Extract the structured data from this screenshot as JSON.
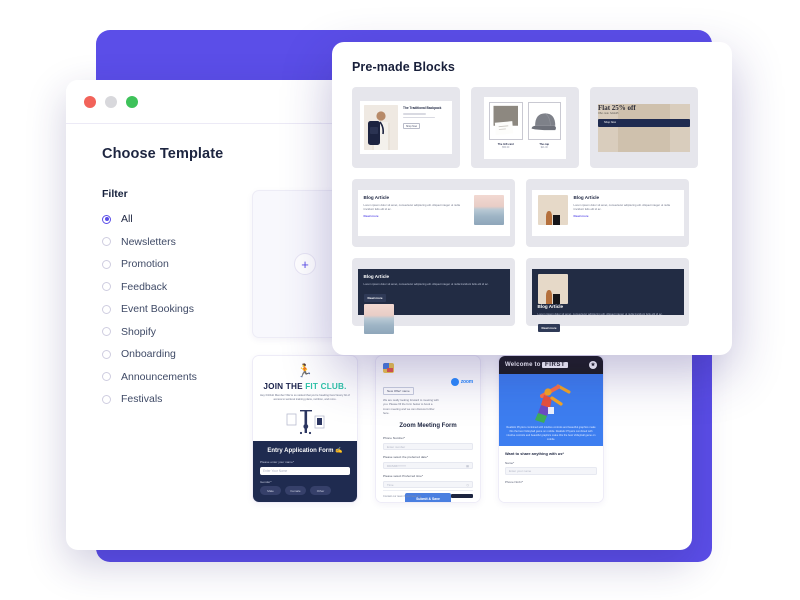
{
  "backdrop": {
    "color": "#5b4ee8"
  },
  "window": {
    "traffic_lights": [
      "close",
      "minimize",
      "maximize"
    ],
    "page_title": "Choose Template"
  },
  "filter": {
    "heading": "Filter",
    "items": [
      {
        "label": "All",
        "selected": true
      },
      {
        "label": "Newsletters",
        "selected": false
      },
      {
        "label": "Promotion",
        "selected": false
      },
      {
        "label": "Feedback",
        "selected": false
      },
      {
        "label": "Event Bookings",
        "selected": false
      },
      {
        "label": "Shopify",
        "selected": false
      },
      {
        "label": "Onboarding",
        "selected": false
      },
      {
        "label": "Announcements",
        "selected": false
      },
      {
        "label": "Festivals",
        "selected": false
      }
    ]
  },
  "templates": {
    "add_card": {
      "icon": "plus-icon",
      "label": "+"
    },
    "fit_club": {
      "icon": "runner-icon",
      "title_1": "JOIN THE ",
      "title_2": "FIT CLUB.",
      "subtitle": "Hey FitClub Member!\nWe're so stoked that you're heading here! Every bit of access to workout training plans, nutrition, and more.",
      "form_title": "Entry Application Form",
      "form_emoji": "✍",
      "name_label": "Please enter your name*",
      "name_placeholder": "Enter Your Name",
      "gender_label": "Gender*",
      "gender_options": [
        "Male",
        "Female",
        "Other"
      ]
    },
    "zoom_meeting": {
      "logo": "google-icon",
      "tag": "New Offer! name",
      "intro": "We are really looking forward to meeting with you. Please fill the form below to book a zoom meeting and we can discuss further here.",
      "brand": "zoom",
      "title": "Zoom Meeting Form",
      "fields": [
        {
          "label": "Phone Number*",
          "placeholder": "Enter number",
          "icon": ""
        },
        {
          "label": "Please select the preferred date*",
          "placeholder": "DD/MM/YYYY",
          "icon": "calendar-icon"
        },
        {
          "label": "Please select Preferred time*",
          "placeholder": "Time",
          "icon": "clock-icon"
        }
      ],
      "submit_label": "Submit & Save",
      "footer_text": "Contact our team if you have any"
    },
    "welcome_first": {
      "welcome_prefix": "Welcome to ",
      "welcome_brand": "FIRST",
      "badge": "★",
      "hero_icon": "jumping-athlete",
      "hero_text": "Realistic Physics combined with intuitive controls and beautiful graphics make this the best Volleyball game on mobile. Realistic Physics combined with intuitive controls and beautiful graphics make this the best Volleyball game on mobile.",
      "question": "Want to share anything with us*",
      "name_label": "Name*",
      "name_placeholder": "Enter your  name",
      "phone_label": "Phone Nmbr*"
    }
  },
  "blocks_panel": {
    "title": "Pre-made Blocks",
    "product_card": {
      "title": "The Traditional Backpack",
      "subtitle": "Black color",
      "price": "$49.00 - $58.00",
      "button": "Shop Now",
      "image": "backpack-model-photo"
    },
    "gift_card": {
      "items": [
        {
          "label": "The Gift card",
          "price": "$50.00",
          "image": "gift-card-photo"
        },
        {
          "label": "The cap",
          "price": "$21.00",
          "image": "grey-cap-photo"
        }
      ]
    },
    "promo_card": {
      "headline": "Flat 25% off",
      "subtext": "Offer code: SALE25",
      "button": "Shop Now"
    },
    "blog_cards": [
      {
        "heading": "Blog Article",
        "body": "Lorem ipsum dolor sit amet, consectetur adipiscing elit. Aliquet integer ut nulla tincidunt felis elit id ac.",
        "link": "Read more",
        "theme": "light",
        "image_side": "right",
        "image": "seascape-photo"
      },
      {
        "heading": "Blog Article",
        "body": "Lorem ipsum dolor sit amet, consectetur adipiscing elit. Aliquet integer ut nulla tincidunt felis elit id ac.",
        "link": "Read more",
        "theme": "light",
        "image_side": "left",
        "image": "vase-still-life-photo"
      },
      {
        "heading": "Blog Article",
        "body": "Lorem ipsum dolor sit amet, consectetur adipiscing elit. Aliquet integer ut nulla tincidunt felis elit id ac.",
        "link": "Read more",
        "theme": "dark",
        "image_side": "right",
        "image": "seascape-photo"
      },
      {
        "heading": "Blog Article",
        "body": "Lorem ipsum dolor sit amet, consectetur adipiscing elit. Aliquet integer ut nulla tincidunt felis elit id ac.",
        "link": "Read more",
        "theme": "dark",
        "image_side": "left",
        "image": "vase-still-life-photo"
      }
    ]
  }
}
